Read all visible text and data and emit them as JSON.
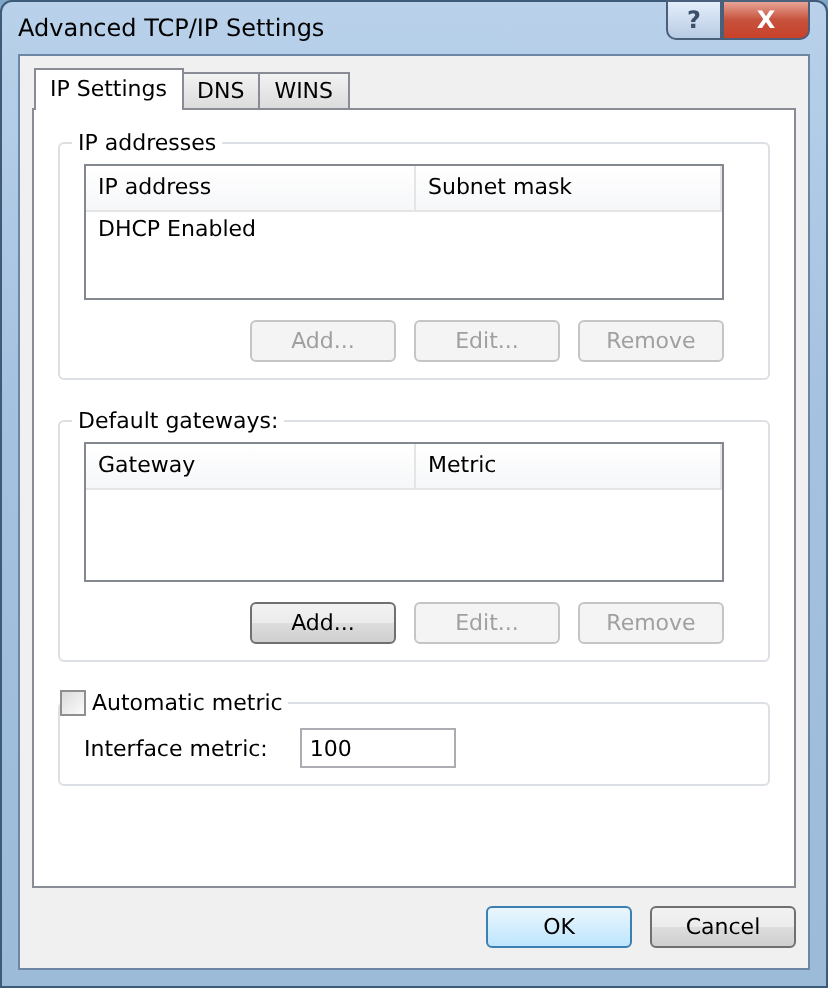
{
  "window": {
    "title": "Advanced TCP/IP Settings",
    "help_button": "?",
    "close_button": "X"
  },
  "tabs": [
    {
      "label": "IP Settings",
      "selected": true
    },
    {
      "label": "DNS",
      "selected": false
    },
    {
      "label": "WINS",
      "selected": false
    }
  ],
  "ip_addresses": {
    "title": "IP addresses",
    "columns": [
      "IP address",
      "Subnet mask"
    ],
    "rows": [
      [
        "DHCP Enabled"
      ]
    ],
    "buttons": [
      {
        "label": "Add...",
        "disabled": true
      },
      {
        "label": "Edit...",
        "disabled": true
      },
      {
        "label": "Remove",
        "disabled": true
      }
    ]
  },
  "default_gateways": {
    "title": "Default gateways:",
    "columns": [
      "Gateway",
      "Metric"
    ],
    "buttons": [
      {
        "label": "Add...",
        "disabled": false
      },
      {
        "label": "Edit...",
        "disabled": true
      },
      {
        "label": "Remove",
        "disabled": true
      }
    ]
  },
  "automatic_metric": {
    "label": "Automatic metric",
    "checked": false
  },
  "interface_metric": {
    "label": "Interface metric:",
    "value": "100"
  },
  "footer_buttons": [
    {
      "label": "OK",
      "default": true
    },
    {
      "label": "Cancel",
      "default": false
    }
  ]
}
